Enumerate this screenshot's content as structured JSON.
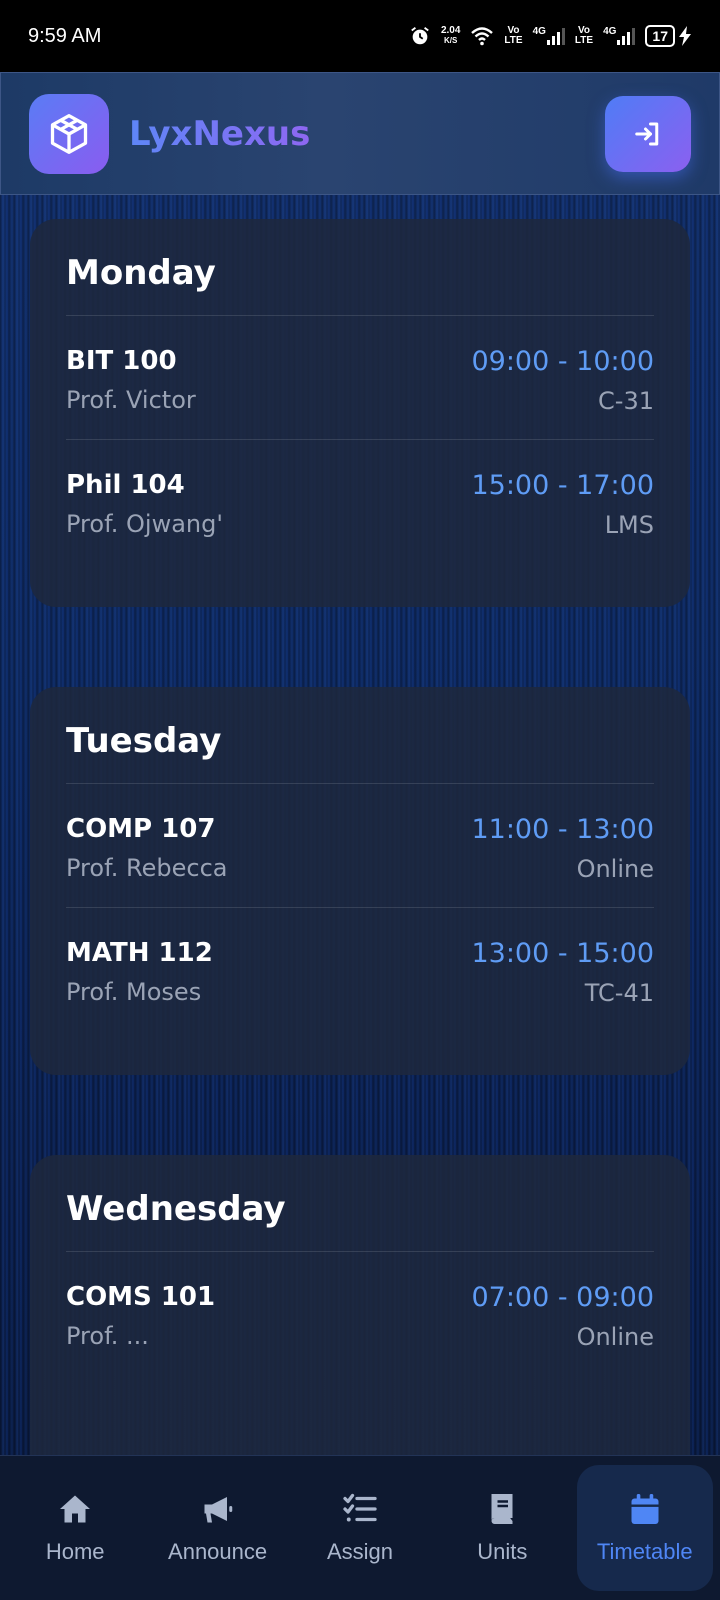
{
  "status_bar": {
    "time": "9:59 AM",
    "speed_value": "2.04",
    "speed_unit": "K/S",
    "net1_top": "Vo",
    "net1_bottom": "LTE",
    "net1_gen": "4G",
    "net2_top": "Vo",
    "net2_bottom": "LTE",
    "net2_gen": "4G",
    "battery": "17",
    "icons": [
      "alarm-icon",
      "wifi-icon",
      "signal-icon",
      "battery-icon",
      "charging-icon"
    ]
  },
  "header": {
    "brand": "LyxNexus",
    "logo_icon": "cube-icon",
    "login_icon": "sign-in-icon"
  },
  "days": [
    {
      "name": "Monday",
      "sessions": [
        {
          "course": "BIT 100",
          "prof": "Prof. Victor",
          "time": "09:00 - 10:00",
          "room": "C-31"
        },
        {
          "course": "Phil 104",
          "prof": "Prof. Ojwang'",
          "time": "15:00 - 17:00",
          "room": "LMS"
        }
      ]
    },
    {
      "name": "Tuesday",
      "sessions": [
        {
          "course": "COMP 107",
          "prof": "Prof. Rebecca",
          "time": "11:00 - 13:00",
          "room": "Online"
        },
        {
          "course": "MATH 112",
          "prof": "Prof. Moses",
          "time": "13:00 - 15:00",
          "room": "TC-41"
        }
      ]
    },
    {
      "name": "Wednesday",
      "sessions": [
        {
          "course": "COMS 101",
          "prof": "Prof. ...",
          "time": "07:00 - 09:00",
          "room": "Online"
        }
      ]
    }
  ],
  "nav": [
    {
      "label": "Home",
      "icon": "home-icon"
    },
    {
      "label": "Announce",
      "icon": "megaphone-icon"
    },
    {
      "label": "Assign",
      "icon": "task-list-icon"
    },
    {
      "label": "Units",
      "icon": "book-icon"
    },
    {
      "label": "Timetable",
      "icon": "calendar-icon",
      "active": true
    }
  ],
  "colors": {
    "accent": "#5f9cf5",
    "brand_start": "#5e86f7",
    "brand_end": "#8e67f2",
    "nav_active": "#4f86f5"
  }
}
